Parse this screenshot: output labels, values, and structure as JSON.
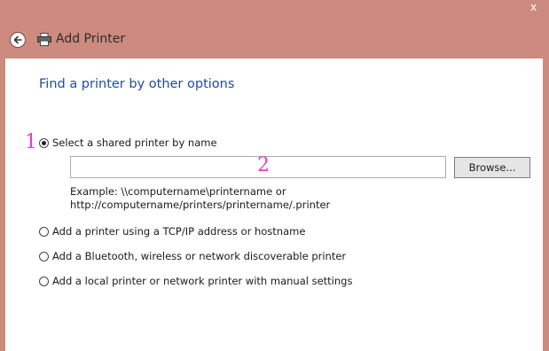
{
  "window": {
    "title": "Add Printer",
    "close_glyph": "x"
  },
  "main": {
    "heading": "Find a printer by other options",
    "options": [
      {
        "label": "Select a shared printer by name",
        "checked": true
      },
      {
        "label": "Add a printer using a TCP/IP address or hostname",
        "checked": false
      },
      {
        "label": "Add a Bluetooth, wireless or network discoverable printer",
        "checked": false
      },
      {
        "label": "Add a local printer or network printer with manual settings",
        "checked": false
      }
    ],
    "printer_name_value": "",
    "browse_label": "Browse...",
    "example_line1": "Example: \\\\computername\\printername or",
    "example_line2": "http://computername/printers/printername/.printer"
  },
  "annotations": {
    "marker_1": "1",
    "marker_2": "2"
  },
  "colors": {
    "titlebar": "#cd8b7f",
    "heading": "#1f4b9a",
    "annotation": "#e040c8"
  }
}
